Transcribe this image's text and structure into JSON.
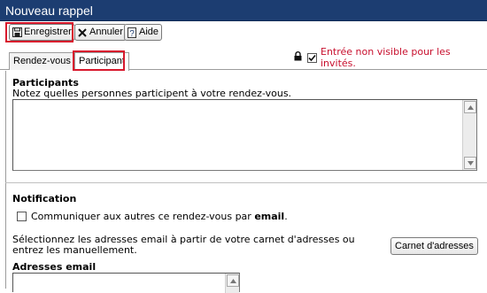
{
  "window": {
    "title": "Nouveau rappel"
  },
  "toolbar": {
    "save_label": "Enregistrer",
    "cancel_label": "Annuler",
    "help_label": "Aide"
  },
  "tabs": [
    {
      "label": "Rendez-vous",
      "active": false
    },
    {
      "label": "Participant",
      "active": true
    }
  ],
  "privacy": {
    "checked": true,
    "label": "Entrée non visible pour les invités."
  },
  "participants": {
    "title": "Participants",
    "description": "Notez quelles personnes participent à votre rendez-vous.",
    "value": ""
  },
  "notification": {
    "title": "Notification",
    "checkbox_checked": false,
    "checkbox_label_prefix": "Communiquer aux autres ce rendez-vous par ",
    "checkbox_label_bold": "email",
    "checkbox_label_suffix": ".",
    "select_line1": "Sélectionnez les adresses email à partir de votre carnet d'adresses ou",
    "select_line2": "entrez les manuellement.",
    "address_book_button": "Carnet d'adresses",
    "emails_title": "Adresses email",
    "emails_value": ""
  },
  "colors": {
    "titlebar": "#1c3d71",
    "highlight": "#d8192d",
    "privacy_text": "#c8102e"
  },
  "icons": [
    "save-icon",
    "cancel-icon",
    "help-icon",
    "lock-icon",
    "scroll-up-icon",
    "scroll-down-icon"
  ]
}
